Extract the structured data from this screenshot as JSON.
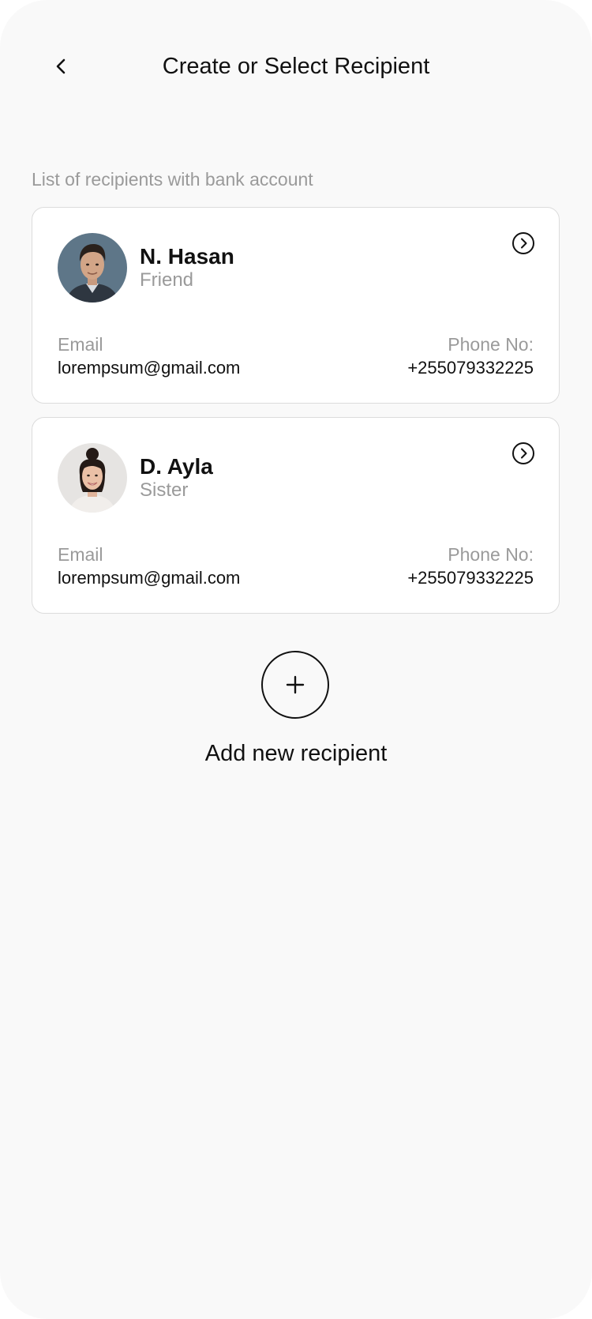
{
  "header": {
    "title": "Create or Select Recipient",
    "back_icon": "chevron-left-icon"
  },
  "section_label": "List of recipients with bank account",
  "recipients": [
    {
      "name": "N. Hasan",
      "relation": "Friend",
      "email_label": "Email",
      "email": "lorempsum@gmail.com",
      "phone_label": "Phone No:",
      "phone": "+255079332225",
      "action_icon": "chevron-right-circle-icon"
    },
    {
      "name": "D. Ayla",
      "relation": "Sister",
      "email_label": "Email",
      "email": "lorempsum@gmail.com",
      "phone_label": "Phone No:",
      "phone": "+255079332225",
      "action_icon": "chevron-right-circle-icon"
    }
  ],
  "add_recipient": {
    "label": "Add new recipient",
    "icon": "plus-icon"
  },
  "colors": {
    "background": "#f9f9f9",
    "card": "#ffffff",
    "border": "#dcdcdc",
    "text_primary": "#111111",
    "text_secondary": "#9a9a9a"
  }
}
